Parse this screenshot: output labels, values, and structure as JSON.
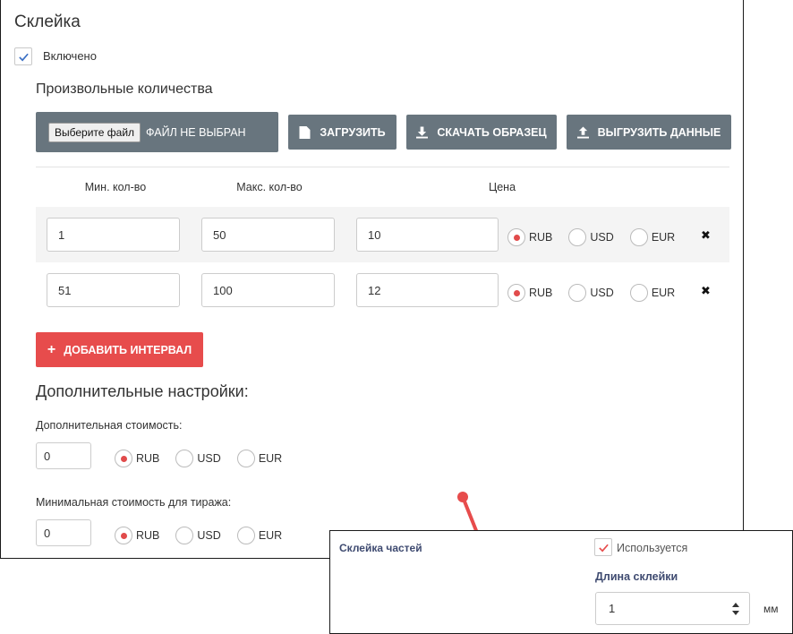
{
  "panel": {
    "title": "Склейка",
    "enabled_label": "Включено",
    "enabled_checked": true,
    "subtitle": "Произвольные количества",
    "file": {
      "choose_label": "Выберите файл",
      "status": "ФАЙЛ НЕ ВЫБРАН"
    },
    "toolbar": {
      "upload_label": "ЗАГРУЗИТЬ",
      "sample_label": "СКАЧАТЬ ОБРАЗЕЦ",
      "export_label": "ВЫГРУЗИТЬ ДАННЫЕ"
    },
    "table": {
      "headers": [
        "Мин. кол-во",
        "Макс. кол-во",
        "Цена"
      ],
      "rows": [
        {
          "min": "1",
          "max": "50",
          "price": "10",
          "currency": "RUB"
        },
        {
          "min": "51",
          "max": "100",
          "price": "12",
          "currency": "RUB"
        }
      ],
      "currencies": [
        "RUB",
        "USD",
        "EUR"
      ],
      "remove_glyph": "✖"
    },
    "add_interval_label": "ДОБАВИТЬ ИНТЕРВАЛ",
    "extra": {
      "heading": "Дополнительные настройки:",
      "extra_cost": {
        "label": "Дополнительная стоимость:",
        "value": "0",
        "currency": "RUB"
      },
      "min_cost": {
        "label": "Минимальная стоимость для тиража:",
        "value": "0",
        "currency": "RUB"
      }
    }
  },
  "popup": {
    "title": "Склейка частей",
    "used_label": "Используется",
    "used_checked": true,
    "length_label": "Длина склейки",
    "length_value": "1",
    "unit": "мм"
  },
  "colors": {
    "accent_red": "#e74c4c",
    "button_gray": "#68757e",
    "check_blue": "#3a6fc4",
    "label_navy": "#3e4a70"
  }
}
